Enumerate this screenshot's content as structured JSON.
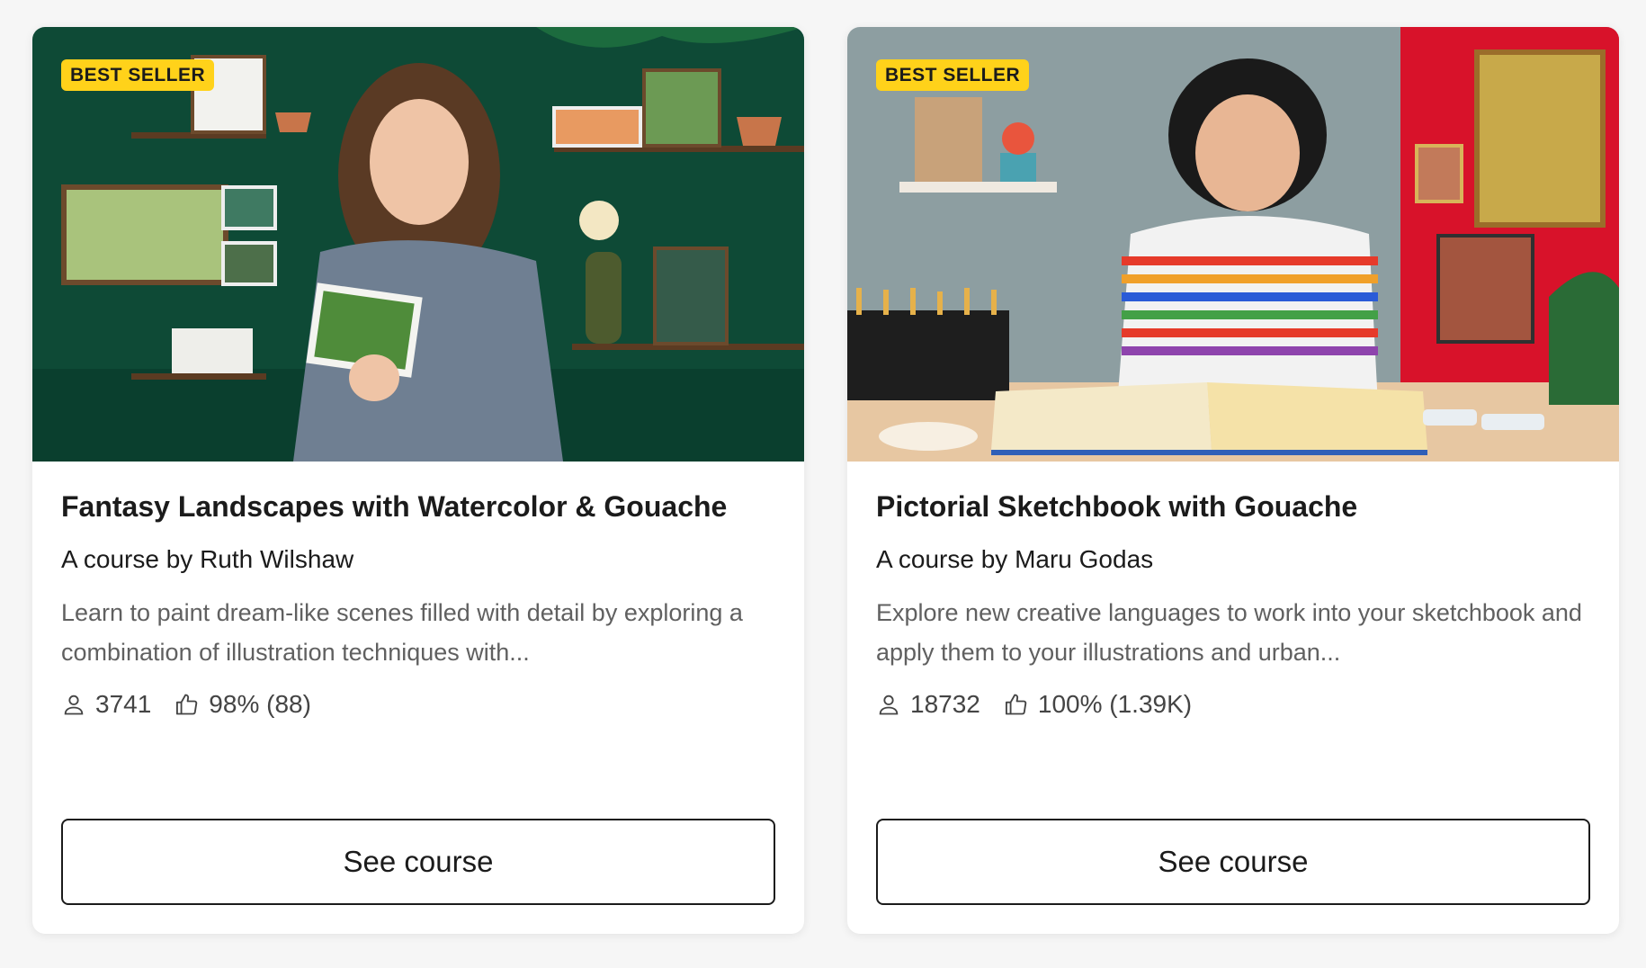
{
  "cards": [
    {
      "badge": "BEST SELLER",
      "title": "Fantasy Landscapes with Watercolor & Gouache",
      "author": "A course by Ruth Wilshaw",
      "description": "Learn to paint dream-like scenes filled with detail by exploring a combination of illustration techniques with...",
      "students": "3741",
      "rating": "98% (88)",
      "button": "See course"
    },
    {
      "badge": "BEST SELLER",
      "title": "Pictorial Sketchbook with Gouache",
      "author": "A course by Maru Godas",
      "description": "Explore new creative languages to work into your sketchbook and apply them to your illustrations and urban...",
      "students": "18732",
      "rating": "100% (1.39K)",
      "button": "See course"
    }
  ],
  "colors": {
    "badge": "#ffd21a",
    "card1_bg": "#0e4a36",
    "card2_wall": "#8d9ea1",
    "card2_red": "#d8122a"
  },
  "icons": [
    "user-icon",
    "thumbs-up-icon"
  ]
}
